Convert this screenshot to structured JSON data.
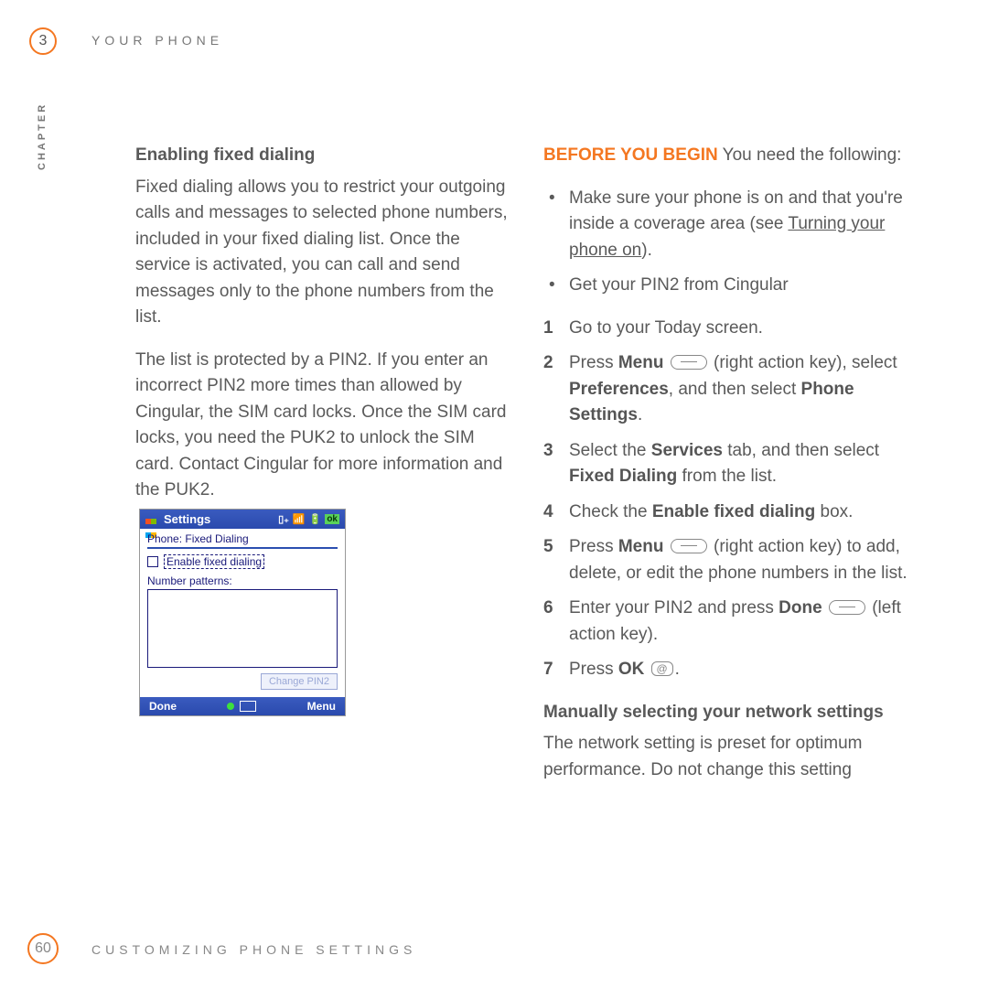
{
  "header": {
    "chapter_num": "3",
    "running_head": "YOUR PHONE",
    "chapter_label": "CHAPTER"
  },
  "left": {
    "h1": "Enabling fixed dialing",
    "p1": "Fixed dialing allows you to restrict your outgoing calls and messages to selected phone numbers, included in your fixed dialing list. Once the service is activated, you can call and send messages only to the phone numbers from the list.",
    "p2": "The list is protected by a PIN2. If you enter an incorrect PIN2 more times than allowed by Cingular, the SIM card locks. Once the SIM card locks, you need the PUK2 to unlock the SIM card. Contact Cingular for more information and the PUK2."
  },
  "screenshot": {
    "title": "Settings",
    "subtitle": "Phone: Fixed Dialing",
    "checkbox_label": "Enable fixed dialing",
    "list_label": "Number patterns:",
    "disabled_button": "Change PIN2",
    "soft_left": "Done",
    "soft_right": "Menu"
  },
  "right": {
    "before_tag": "BEFORE YOU BEGIN",
    "before_rest": "  You need the following:",
    "bullets": [
      {
        "pre": "Make sure your phone is on and that you're inside a coverage area (see ",
        "link": "Turning your phone on",
        "post": ")."
      },
      {
        "pre": "Get your PIN2 from Cingular",
        "link": "",
        "post": ""
      }
    ],
    "steps": {
      "s1": "Go to your Today screen.",
      "s2_a": "Press ",
      "s2_b": "Menu",
      "s2_c": " (right action key), select ",
      "s2_d": "Preferences",
      "s2_e": ", and then select ",
      "s2_f": "Phone Settings",
      "s2_g": ".",
      "s3_a": "Select the ",
      "s3_b": "Services",
      "s3_c": " tab, and then select ",
      "s3_d": "Fixed Dialing",
      "s3_e": " from the list.",
      "s4_a": "Check the ",
      "s4_b": "Enable fixed dialing",
      "s4_c": " box.",
      "s5_a": "Press ",
      "s5_b": "Menu",
      "s5_c": " (right action key) to add, delete, or edit the phone numbers in the list.",
      "s6_a": "Enter your PIN2 and press ",
      "s6_b": "Done",
      "s6_c": " (left action key).",
      "s7_a": "Press ",
      "s7_b": "OK",
      "s7_c": "."
    },
    "h2": "Manually selecting your network settings",
    "p_end": "The network setting is preset for optimum performance. Do not change this setting"
  },
  "footer": {
    "page": "60",
    "text": "CUSTOMIZING PHONE SETTINGS"
  }
}
